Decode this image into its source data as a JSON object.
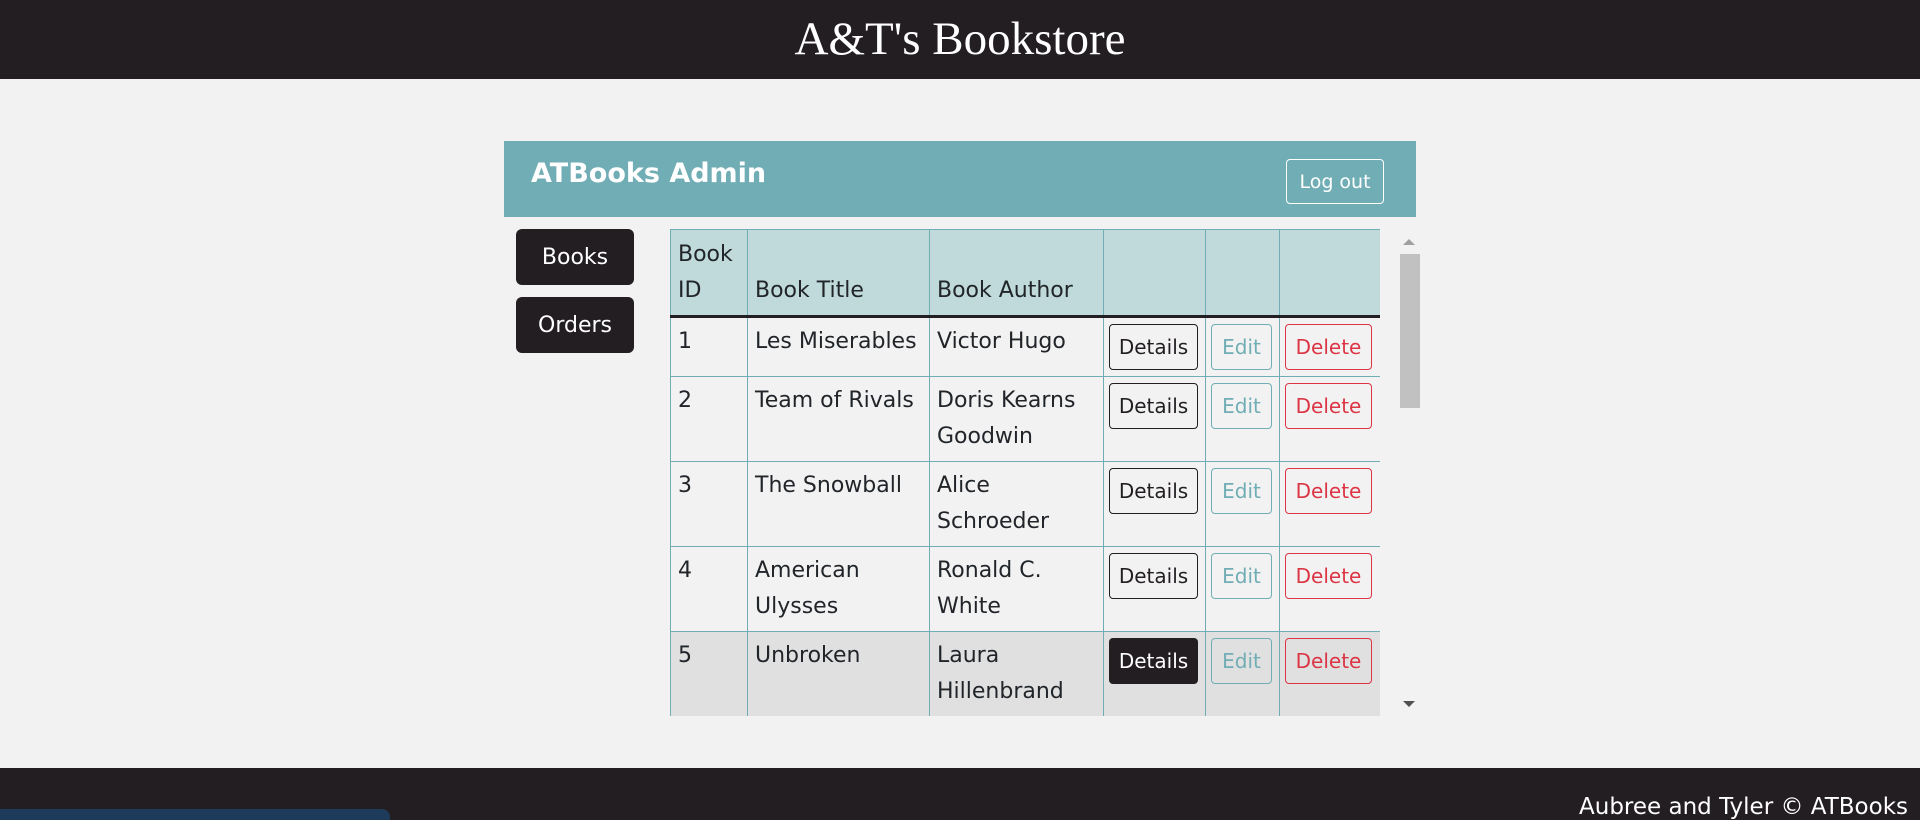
{
  "site": {
    "title": "A&T's Bookstore"
  },
  "admin": {
    "title": "ATBooks Admin",
    "logout_label": "Log out"
  },
  "nav": {
    "items": [
      {
        "label": "Books"
      },
      {
        "label": "Orders"
      }
    ]
  },
  "table": {
    "headers": [
      "Book ID",
      "Book Title",
      "Book Author",
      "",
      "",
      ""
    ],
    "rows": [
      {
        "id": "1",
        "title": "Les Miserables",
        "author": "Victor Hugo"
      },
      {
        "id": "2",
        "title": "Team of Rivals",
        "author": "Doris Kearns Goodwin"
      },
      {
        "id": "3",
        "title": "The Snowball",
        "author": "Alice Schroeder"
      },
      {
        "id": "4",
        "title": "American Ulysses",
        "author": "Ronald C. White"
      },
      {
        "id": "5",
        "title": "Unbroken",
        "author": "Laura Hillenbrand"
      }
    ],
    "actions": {
      "details": "Details",
      "edit": "Edit",
      "delete": "Delete"
    }
  },
  "footer": {
    "text": "Aubree and Tyler © ATBooks"
  },
  "colors": {
    "header_bg": "#221e22",
    "accent": "#71adb5",
    "table_header_bg": "#c0dadb",
    "danger": "#dc3545",
    "page_bg": "#f2f2f2"
  }
}
